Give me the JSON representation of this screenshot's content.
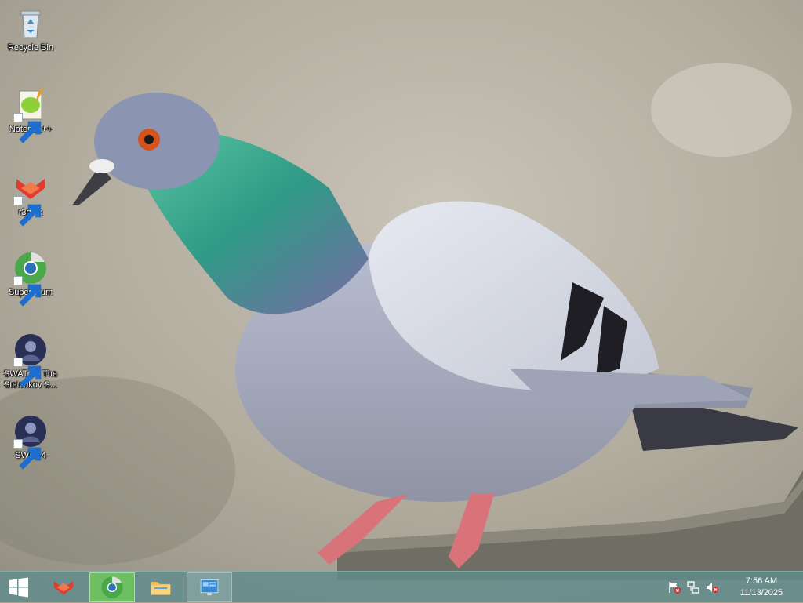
{
  "desktop": {
    "icons": [
      {
        "label": "Recycle Bin",
        "icon": "recycle-bin-icon"
      },
      {
        "label": "Notepad++",
        "icon": "notepad-plus-plus-icon"
      },
      {
        "label": "r3dfox",
        "icon": "r3dfox-icon"
      },
      {
        "label": "Supermium",
        "icon": "supermium-icon"
      },
      {
        "label": "SWAT 4 - The Stetchkov S...",
        "icon": "swat4-icon"
      },
      {
        "label": "SWAT 4",
        "icon": "swat4-icon"
      }
    ],
    "wallpaper": "pigeon-wallpaper"
  },
  "taskbar": {
    "start": {
      "icon": "windows-logo-icon"
    },
    "pinned": [
      {
        "icon": "r3dfox-icon",
        "state": "normal"
      },
      {
        "icon": "supermium-icon",
        "state": "active"
      },
      {
        "icon": "file-explorer-icon",
        "state": "normal"
      },
      {
        "icon": "control-panel-icon",
        "state": "open"
      }
    ],
    "tray": {
      "icons": [
        "action-center-flag-icon",
        "network-icon",
        "volume-muted-icon"
      ],
      "time": "7:56 AM",
      "date": "11/13/2025"
    }
  },
  "colors": {
    "taskbar": "#608c8c",
    "active_button": "#6ec85a"
  }
}
